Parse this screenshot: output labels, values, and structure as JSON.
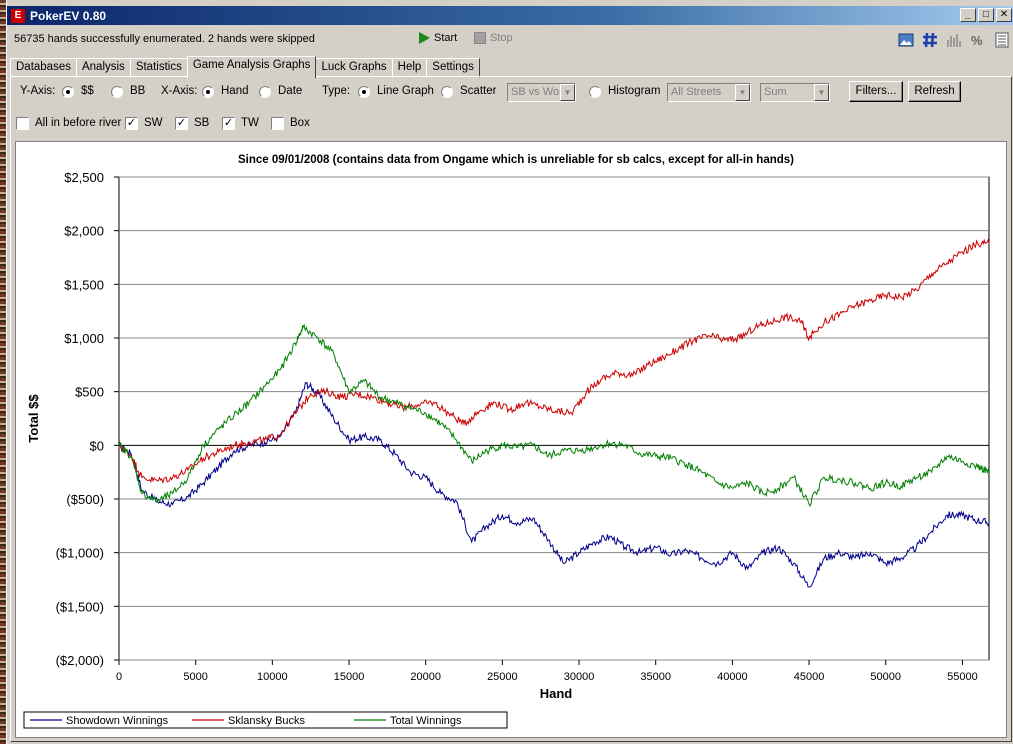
{
  "window": {
    "title": "PokerEV 0.80",
    "icon_letter": "E",
    "buttons": [
      "_",
      "□",
      "✕"
    ]
  },
  "status": {
    "message": "56735 hands successfully enumerated. 2 hands were skipped",
    "start_label": "Start",
    "stop_label": "Stop"
  },
  "tabs": [
    {
      "label": "Databases",
      "active": false
    },
    {
      "label": "Analysis",
      "active": false
    },
    {
      "label": "Statistics",
      "active": false
    },
    {
      "label": "Game Analysis Graphs",
      "active": true
    },
    {
      "label": "Luck Graphs",
      "active": false
    },
    {
      "label": "Help",
      "active": false
    },
    {
      "label": "Settings",
      "active": false
    }
  ],
  "controls": {
    "yaxis_label": "Y-Axis:",
    "yaxis_opt1": "$$",
    "yaxis_opt2": "BB",
    "xaxis_label": "X-Axis:",
    "xaxis_opt1": "Hand",
    "xaxis_opt2": "Date",
    "type_label": "Type:",
    "type_line": "Line Graph",
    "type_scatter": "Scatter",
    "scatter_combo": "SB vs Wo",
    "type_hist": "Histogram",
    "streets_combo": "All Streets",
    "sum_combo": "Sum",
    "filters_button": "Filters...",
    "refresh_button": "Refresh",
    "check_allin": "All in before river",
    "check_sw": "SW",
    "check_sb": "SB",
    "check_tw": "TW",
    "check_box": "Box",
    "checkmark": "✓"
  },
  "chart_data": {
    "type": "line",
    "title": "Since 09/01/2008  (contains data from Ongame which is unreliable for sb calcs, except for all-in hands)",
    "xlabel": "Hand",
    "ylabel": "Total $$",
    "xlim": [
      0,
      56735
    ],
    "ylim": [
      -2000,
      2500
    ],
    "x_ticks": [
      0,
      5000,
      10000,
      15000,
      20000,
      25000,
      30000,
      35000,
      40000,
      45000,
      50000,
      55000
    ],
    "x_tick_labels": [
      "0",
      "5000",
      "10000",
      "15000",
      "20000",
      "25000",
      "30000",
      "35000",
      "40000",
      "45000",
      "50000",
      "55000"
    ],
    "y_ticks": [
      2500,
      2000,
      1500,
      1000,
      500,
      0,
      -500,
      -1000,
      -1500,
      -2000
    ],
    "y_tick_labels": [
      "$2,500",
      "$2,000",
      "$1,500",
      "$1,000",
      "$500",
      "$0",
      "($500)",
      "($1,000)",
      "($1,500)",
      "($2,000)"
    ],
    "grid": "horizontal",
    "legend_position": "bottom-left",
    "series": [
      {
        "name": "Showdown Winnings",
        "color": "#00008b",
        "points": [
          [
            0,
            0
          ],
          [
            800,
            -80
          ],
          [
            1500,
            -420
          ],
          [
            2500,
            -520
          ],
          [
            3500,
            -550
          ],
          [
            4500,
            -480
          ],
          [
            5500,
            -350
          ],
          [
            6500,
            -200
          ],
          [
            7500,
            -50
          ],
          [
            8500,
            0
          ],
          [
            9500,
            30
          ],
          [
            10500,
            80
          ],
          [
            11500,
            300
          ],
          [
            12200,
            580
          ],
          [
            13000,
            480
          ],
          [
            14000,
            250
          ],
          [
            15000,
            50
          ],
          [
            16000,
            80
          ],
          [
            17000,
            50
          ],
          [
            18000,
            -80
          ],
          [
            19000,
            -250
          ],
          [
            20000,
            -300
          ],
          [
            21000,
            -450
          ],
          [
            22000,
            -520
          ],
          [
            23000,
            -900
          ],
          [
            24000,
            -750
          ],
          [
            25000,
            -650
          ],
          [
            26000,
            -720
          ],
          [
            27000,
            -680
          ],
          [
            28000,
            -880
          ],
          [
            29000,
            -1100
          ],
          [
            30000,
            -1000
          ],
          [
            31000,
            -900
          ],
          [
            32000,
            -850
          ],
          [
            33000,
            -950
          ],
          [
            34000,
            -1000
          ],
          [
            35000,
            -950
          ],
          [
            36000,
            -1020
          ],
          [
            37000,
            -980
          ],
          [
            38000,
            -1050
          ],
          [
            39000,
            -1100
          ],
          [
            40000,
            -1000
          ],
          [
            41000,
            -1150
          ],
          [
            42000,
            -1000
          ],
          [
            43000,
            -950
          ],
          [
            44000,
            -1100
          ],
          [
            45000,
            -1320
          ],
          [
            46000,
            -1050
          ],
          [
            47000,
            -1000
          ],
          [
            48000,
            -1050
          ],
          [
            49000,
            -1000
          ],
          [
            50000,
            -1100
          ],
          [
            51000,
            -1050
          ],
          [
            52000,
            -950
          ],
          [
            53000,
            -800
          ],
          [
            54000,
            -650
          ],
          [
            55000,
            -650
          ],
          [
            56000,
            -700
          ],
          [
            56735,
            -720
          ]
        ]
      },
      {
        "name": "Sklansky Bucks",
        "color": "#cc0000",
        "points": [
          [
            0,
            0
          ],
          [
            800,
            -100
          ],
          [
            1500,
            -300
          ],
          [
            2500,
            -330
          ],
          [
            3500,
            -300
          ],
          [
            4500,
            -230
          ],
          [
            5500,
            -120
          ],
          [
            6500,
            -60
          ],
          [
            7500,
            0
          ],
          [
            8500,
            30
          ],
          [
            9500,
            50
          ],
          [
            10500,
            100
          ],
          [
            11500,
            300
          ],
          [
            12500,
            480
          ],
          [
            13500,
            500
          ],
          [
            14500,
            450
          ],
          [
            15500,
            480
          ],
          [
            16500,
            450
          ],
          [
            17500,
            400
          ],
          [
            18500,
            350
          ],
          [
            19500,
            380
          ],
          [
            20500,
            400
          ],
          [
            21500,
            300
          ],
          [
            22500,
            200
          ],
          [
            23500,
            320
          ],
          [
            24500,
            400
          ],
          [
            25500,
            330
          ],
          [
            26500,
            400
          ],
          [
            27500,
            360
          ],
          [
            28500,
            320
          ],
          [
            29500,
            300
          ],
          [
            30500,
            500
          ],
          [
            31500,
            620
          ],
          [
            32500,
            680
          ],
          [
            33500,
            650
          ],
          [
            34500,
            750
          ],
          [
            35500,
            820
          ],
          [
            36500,
            900
          ],
          [
            37500,
            980
          ],
          [
            38500,
            1020
          ],
          [
            39500,
            980
          ],
          [
            40500,
            1000
          ],
          [
            41500,
            1100
          ],
          [
            42500,
            1150
          ],
          [
            43500,
            1200
          ],
          [
            44500,
            1150
          ],
          [
            45000,
            1000
          ],
          [
            46000,
            1150
          ],
          [
            47000,
            1220
          ],
          [
            48000,
            1300
          ],
          [
            49000,
            1350
          ],
          [
            50000,
            1400
          ],
          [
            51000,
            1380
          ],
          [
            52000,
            1450
          ],
          [
            53000,
            1600
          ],
          [
            54000,
            1700
          ],
          [
            55000,
            1800
          ],
          [
            56000,
            1880
          ],
          [
            56735,
            1880
          ]
        ]
      },
      {
        "name": "Total Winnings",
        "color": "#008000",
        "points": [
          [
            0,
            0
          ],
          [
            800,
            -100
          ],
          [
            1500,
            -450
          ],
          [
            2500,
            -520
          ],
          [
            3500,
            -450
          ],
          [
            4500,
            -300
          ],
          [
            5500,
            0
          ],
          [
            6500,
            150
          ],
          [
            7500,
            280
          ],
          [
            8500,
            400
          ],
          [
            9500,
            550
          ],
          [
            10500,
            700
          ],
          [
            11500,
            950
          ],
          [
            12000,
            1100
          ],
          [
            13000,
            1000
          ],
          [
            14000,
            850
          ],
          [
            15000,
            500
          ],
          [
            16000,
            600
          ],
          [
            17000,
            450
          ],
          [
            18000,
            400
          ],
          [
            19000,
            350
          ],
          [
            20000,
            300
          ],
          [
            21000,
            200
          ],
          [
            22000,
            50
          ],
          [
            23000,
            -150
          ],
          [
            24000,
            -50
          ],
          [
            25000,
            0
          ],
          [
            26000,
            -20
          ],
          [
            27000,
            0
          ],
          [
            28000,
            -100
          ],
          [
            29000,
            -50
          ],
          [
            30000,
            -50
          ],
          [
            31000,
            -20
          ],
          [
            32000,
            20
          ],
          [
            33000,
            0
          ],
          [
            34000,
            -80
          ],
          [
            35000,
            -100
          ],
          [
            36000,
            -120
          ],
          [
            37000,
            -180
          ],
          [
            38000,
            -250
          ],
          [
            39000,
            -350
          ],
          [
            40000,
            -400
          ],
          [
            41000,
            -350
          ],
          [
            42000,
            -450
          ],
          [
            43000,
            -400
          ],
          [
            44000,
            -300
          ],
          [
            45000,
            -550
          ],
          [
            46000,
            -300
          ],
          [
            47000,
            -320
          ],
          [
            48000,
            -350
          ],
          [
            49000,
            -400
          ],
          [
            50000,
            -350
          ],
          [
            51000,
            -380
          ],
          [
            52000,
            -300
          ],
          [
            53000,
            -250
          ],
          [
            54000,
            -100
          ],
          [
            55000,
            -150
          ],
          [
            56000,
            -200
          ],
          [
            56735,
            -250
          ]
        ]
      }
    ]
  }
}
